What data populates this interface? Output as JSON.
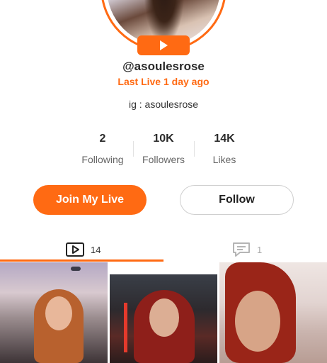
{
  "profile": {
    "username": "@asoulesrose",
    "last_live": "Last Live 1 day ago",
    "bio": "ig : asoulesrose"
  },
  "stats": [
    {
      "value": "2",
      "label": "Following"
    },
    {
      "value": "10K",
      "label": "Followers"
    },
    {
      "value": "14K",
      "label": "Likes"
    }
  ],
  "actions": {
    "join_label": "Join My Live",
    "follow_label": "Follow"
  },
  "tabs": [
    {
      "icon": "video-icon",
      "count": "14",
      "active": true
    },
    {
      "icon": "comment-icon",
      "count": "1",
      "active": false
    }
  ],
  "colors": {
    "accent": "#ff6a13"
  }
}
